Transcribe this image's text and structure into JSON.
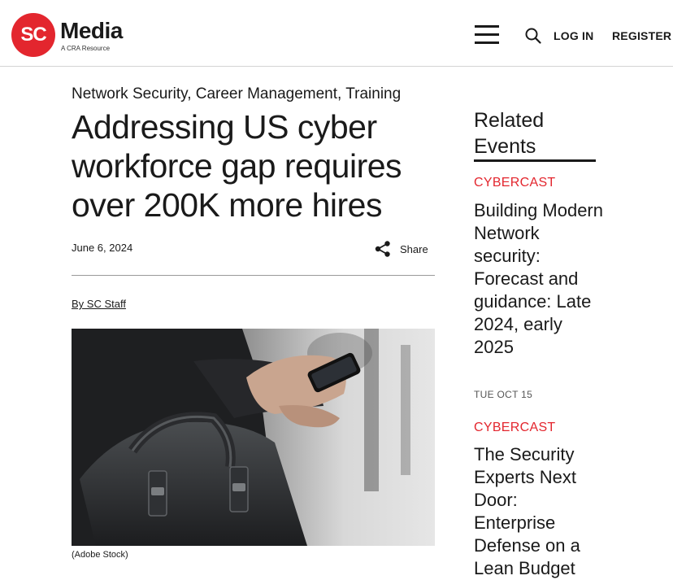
{
  "header": {
    "logo_mark": "SC",
    "logo_word": "Media",
    "logo_sub": "A CRA Resource",
    "login_label": "LOG IN",
    "register_label": "REGISTER"
  },
  "article": {
    "categories": [
      "Network Security",
      "Career Management",
      "Training"
    ],
    "title": "Addressing US cyber workforce gap requires over 200K more hires",
    "date": "June 6, 2024",
    "share_label": "Share",
    "byline": "By SC Staff",
    "image_caption": "(Adobe Stock)"
  },
  "sidebar": {
    "heading": "Related Events",
    "events": [
      {
        "type": "CYBERCAST",
        "title": "Building Modern Network security: Forecast and guidance: Late 2024, early 2025",
        "date": "TUE OCT 15"
      },
      {
        "type": "CYBERCAST",
        "title": "The Security Experts Next Door: Enterprise Defense on a Lean Budget"
      }
    ]
  },
  "icons": {
    "menu": "hamburger-menu-icon",
    "search": "search-icon",
    "share": "share-icon"
  },
  "colors": {
    "brand_red": "#e3262e",
    "text": "#1a1a1a"
  }
}
